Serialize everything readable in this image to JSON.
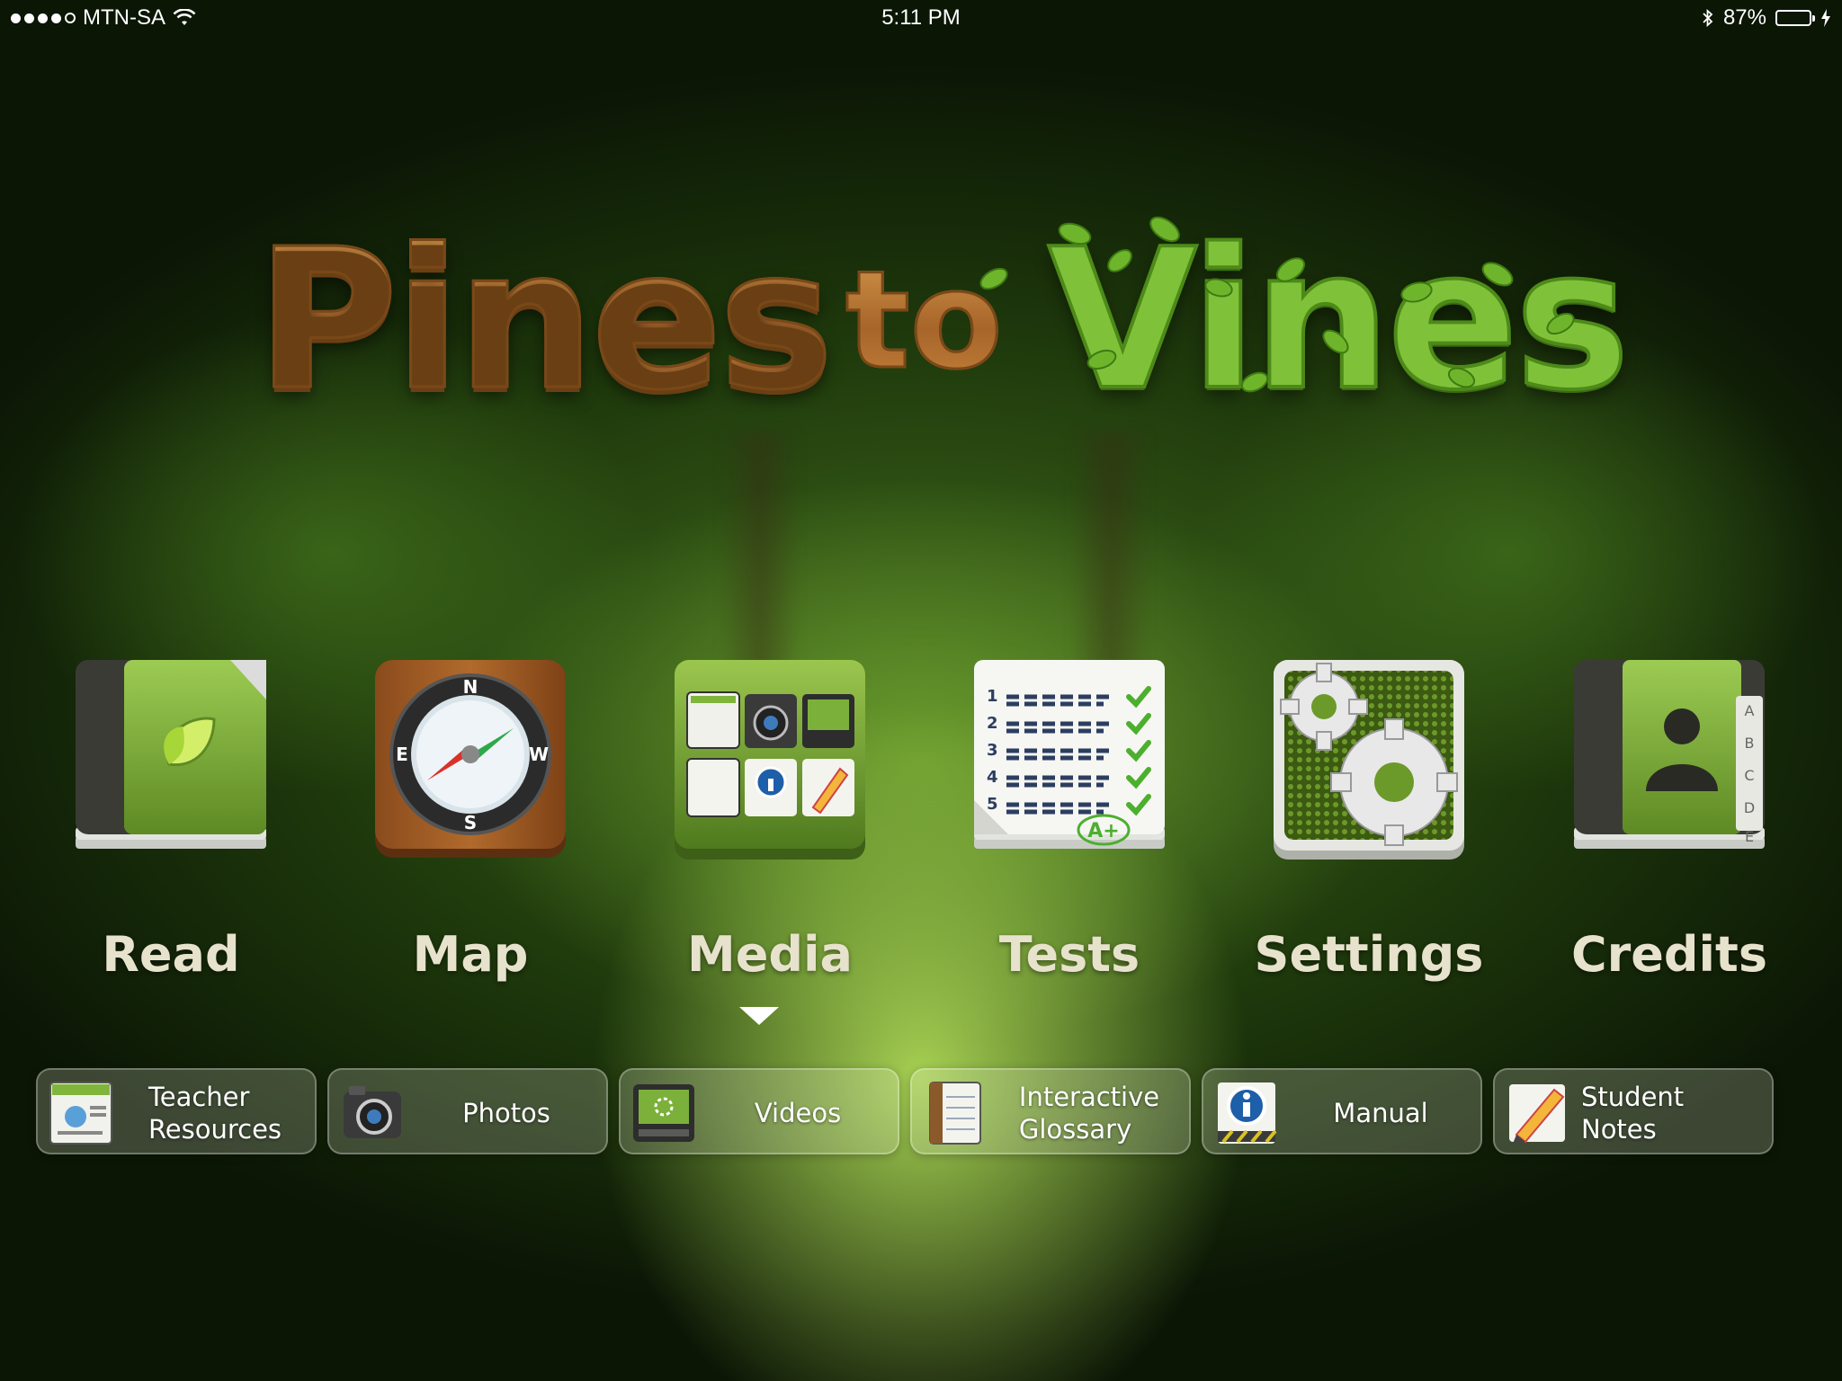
{
  "status_bar": {
    "carrier": "MTN-SA",
    "time": "5:11 PM",
    "battery_percent": "87%",
    "battery_level": 0.87,
    "signal_bars_filled": 4,
    "icons": [
      "signal-dots",
      "wifi-icon",
      "bluetooth-icon",
      "battery-icon",
      "charging-bolt-icon"
    ]
  },
  "logo": {
    "part1": "Pines",
    "part2": "to",
    "part3": "Vines"
  },
  "apps": [
    {
      "label": "Read",
      "icon": "book-leaf-icon"
    },
    {
      "label": "Map",
      "icon": "compass-icon",
      "compass": {
        "n": "N",
        "e": "E",
        "w": "W",
        "s": "S"
      }
    },
    {
      "label": "Media",
      "icon": "media-folder-icon"
    },
    {
      "label": "Tests",
      "icon": "test-checklist-icon",
      "rows": [
        "1",
        "2",
        "3",
        "4",
        "5"
      ],
      "grade": "A+"
    },
    {
      "label": "Settings",
      "icon": "gears-icon"
    },
    {
      "label": "Credits",
      "icon": "address-book-icon",
      "tabs": [
        "A",
        "B",
        "C",
        "D",
        "E"
      ]
    }
  ],
  "selected_app": "Media",
  "media_items": [
    {
      "label": "Teacher\nResources",
      "icon": "teacher-resources-icon"
    },
    {
      "label": "Photos",
      "icon": "camera-icon"
    },
    {
      "label": "Videos",
      "icon": "video-player-icon"
    },
    {
      "label": "Interactive\nGlossary",
      "icon": "notebook-icon"
    },
    {
      "label": "Manual",
      "icon": "info-icon"
    },
    {
      "label": "Student Notes",
      "icon": "pencil-notes-icon"
    }
  ],
  "colors": {
    "wood": "#b5742e",
    "vine_green": "#7fc23a",
    "label_text": "#e7e2cc",
    "app_green": "#7aa83a"
  }
}
